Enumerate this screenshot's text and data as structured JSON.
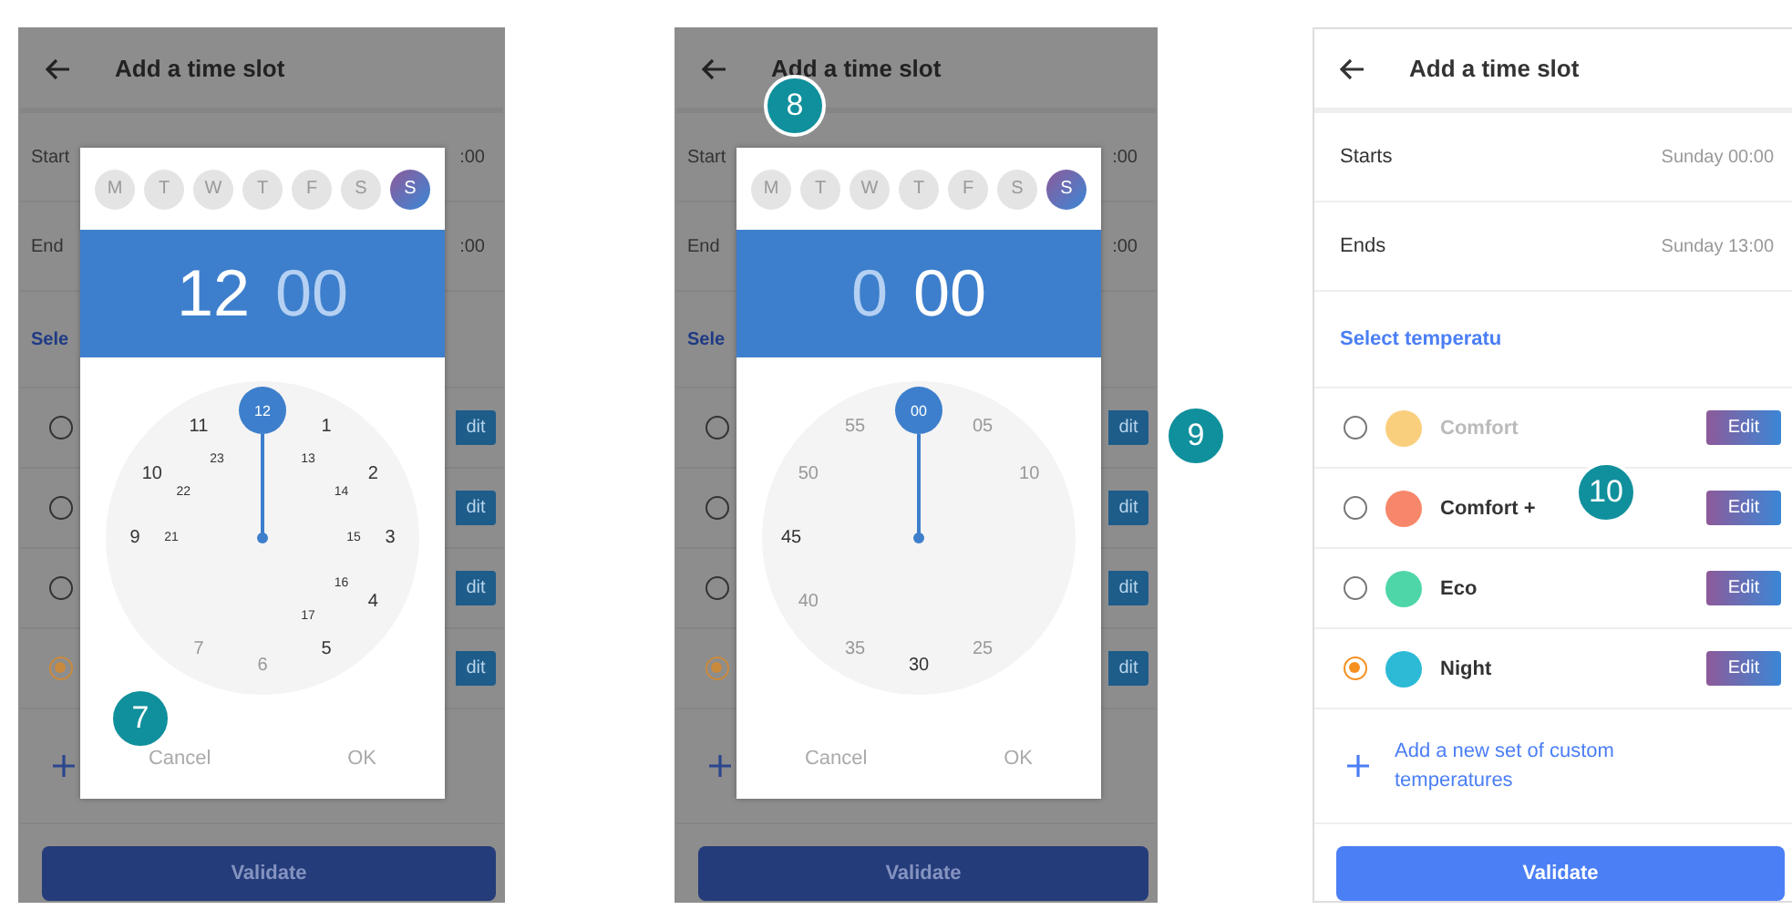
{
  "panels": [
    {
      "kind": "picker",
      "step": "7",
      "header": {
        "title": "Add a time slot"
      },
      "rows": [
        {
          "label": "Start",
          "value": ":00"
        },
        {
          "label": "End",
          "value": ":00"
        }
      ],
      "section": "Sele",
      "options": [
        {
          "selected": false,
          "edit": "dit"
        },
        {
          "selected": false,
          "edit": "dit"
        },
        {
          "selected": false,
          "edit": "dit"
        },
        {
          "selected": true,
          "edit": "dit"
        }
      ],
      "validate": "Validate",
      "dialog": {
        "days": [
          {
            "label": "M",
            "selected": false
          },
          {
            "label": "T",
            "selected": false
          },
          {
            "label": "W",
            "selected": false
          },
          {
            "label": "T",
            "selected": false
          },
          {
            "label": "F",
            "selected": false
          },
          {
            "label": "S",
            "selected": false
          },
          {
            "label": "S",
            "selected": true
          }
        ],
        "hours": {
          "text": "12",
          "active": true
        },
        "minutes": {
          "text": "00",
          "active": false
        },
        "numbers": [
          {
            "text": "12",
            "selected": true,
            "dim": false
          },
          {
            "text": "1",
            "selected": false,
            "dim": false
          },
          {
            "text": "2",
            "selected": false,
            "dim": false
          },
          {
            "text": "3",
            "selected": false,
            "dim": false
          },
          {
            "text": "4",
            "selected": false,
            "dim": false
          },
          {
            "text": "5",
            "selected": false,
            "dim": false
          },
          {
            "text": "6",
            "selected": false,
            "dim": true
          },
          {
            "text": "7",
            "selected": false,
            "dim": true
          },
          {
            "text": "9",
            "selected": false,
            "dim": false
          },
          {
            "text": "10",
            "selected": false,
            "dim": false
          },
          {
            "text": "11",
            "selected": false,
            "dim": false
          },
          {
            "text": "13",
            "selected": false,
            "dim": false
          },
          {
            "text": "14",
            "selected": false,
            "dim": false
          },
          {
            "text": "15",
            "selected": false,
            "dim": false
          },
          {
            "text": "16",
            "selected": false,
            "dim": false
          },
          {
            "text": "17",
            "selected": false,
            "dim": false
          },
          {
            "text": "21",
            "selected": false,
            "dim": false
          },
          {
            "text": "22",
            "selected": false,
            "dim": false
          },
          {
            "text": "23",
            "selected": false,
            "dim": false
          }
        ],
        "cancel": "Cancel",
        "ok": "OK"
      }
    },
    {
      "kind": "picker",
      "step": "8",
      "step_2": "9",
      "header": {
        "title": "Add a time slot"
      },
      "rows": [
        {
          "label": "Start",
          "value": ":00"
        },
        {
          "label": "End",
          "value": ":00"
        }
      ],
      "section": "Sele",
      "options": [
        {
          "selected": false,
          "edit": "dit"
        },
        {
          "selected": false,
          "edit": "dit"
        },
        {
          "selected": false,
          "edit": "dit"
        },
        {
          "selected": true,
          "edit": "dit"
        }
      ],
      "validate": "Validate",
      "dialog": {
        "days": [
          {
            "label": "M",
            "selected": false
          },
          {
            "label": "T",
            "selected": false
          },
          {
            "label": "W",
            "selected": false
          },
          {
            "label": "T",
            "selected": false
          },
          {
            "label": "F",
            "selected": false
          },
          {
            "label": "S",
            "selected": false
          },
          {
            "label": "S",
            "selected": true
          }
        ],
        "hours": {
          "text": "0",
          "active": false
        },
        "minutes": {
          "text": "00",
          "active": true
        },
        "numbers": [
          {
            "text": "00",
            "selected": true,
            "dim": false
          },
          {
            "text": "05",
            "selected": false,
            "dim": true
          },
          {
            "text": "10",
            "selected": false,
            "dim": true
          },
          {
            "text": "25",
            "selected": false,
            "dim": true
          },
          {
            "text": "30",
            "selected": false,
            "dim": false
          },
          {
            "text": "35",
            "selected": false,
            "dim": true
          },
          {
            "text": "40",
            "selected": false,
            "dim": true
          },
          {
            "text": "45",
            "selected": false,
            "dim": false
          },
          {
            "text": "50",
            "selected": false,
            "dim": true
          },
          {
            "text": "55",
            "selected": false,
            "dim": true
          }
        ],
        "cancel": "Cancel",
        "ok": "OK"
      }
    },
    {
      "kind": "list",
      "step": "10",
      "header": {
        "title": "Add a time slot"
      },
      "rows": [
        {
          "label": "Starts",
          "value": "Sunday 00:00"
        },
        {
          "label": "Ends",
          "value": "Sunday 13:00"
        }
      ],
      "section": "Select temperatu",
      "options": [
        {
          "name": "Comfort",
          "color": "#f9cf7e",
          "selected": false,
          "disabled": true,
          "edit": "Edit"
        },
        {
          "name": "Comfort +",
          "color": "#f7876a",
          "selected": false,
          "disabled": false,
          "edit": "Edit"
        },
        {
          "name": "Eco",
          "color": "#4fd6a8",
          "selected": false,
          "disabled": false,
          "edit": "Edit"
        },
        {
          "name": "Night",
          "color": "#2cbad6",
          "selected": true,
          "disabled": false,
          "edit": "Edit"
        }
      ],
      "add": "Add a new set of custom temperatures",
      "validate": "Validate"
    }
  ]
}
